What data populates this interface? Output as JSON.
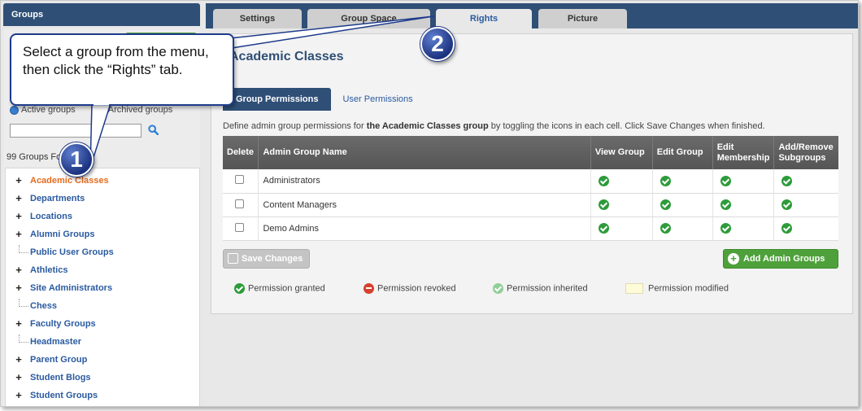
{
  "left_panel": {
    "header": "Groups",
    "radio_active": "Active groups",
    "radio_archived": "Archived groups",
    "search_value": "",
    "groups_found": "99 Groups Found",
    "tree": [
      {
        "label": "Academic Classes",
        "expandable": true,
        "active": true
      },
      {
        "label": "Departments",
        "expandable": true
      },
      {
        "label": "Locations",
        "expandable": true
      },
      {
        "label": "Alumni Groups",
        "expandable": true
      },
      {
        "label": "Public User Groups",
        "expandable": false
      },
      {
        "label": "Athletics",
        "expandable": true
      },
      {
        "label": "Site Administrators",
        "expandable": true
      },
      {
        "label": "Chess",
        "expandable": false
      },
      {
        "label": "Faculty Groups",
        "expandable": true
      },
      {
        "label": "Headmaster",
        "expandable": false
      },
      {
        "label": "Parent Group",
        "expandable": true
      },
      {
        "label": "Student Blogs",
        "expandable": true
      },
      {
        "label": "Student Groups",
        "expandable": true
      }
    ]
  },
  "tabs": [
    {
      "label": "Settings"
    },
    {
      "label": "Group Space"
    },
    {
      "label": "Rights",
      "active": true
    },
    {
      "label": "Picture"
    }
  ],
  "main": {
    "title": "Academic Classes",
    "sub_tabs": [
      {
        "label": "Group Permissions",
        "active": true
      },
      {
        "label": "User Permissions"
      }
    ],
    "description_pre": "Define admin group permissions for ",
    "description_bold": "the Academic Classes group",
    "description_post": " by toggling the icons in each cell. Click Save Changes when finished.",
    "table": {
      "headers": [
        "Delete",
        "Admin Group Name",
        "View Group",
        "Edit Group",
        "Edit Membership",
        "Add/Remove Subgroups"
      ],
      "rows": [
        {
          "name": "Administrators"
        },
        {
          "name": "Content Managers"
        },
        {
          "name": "Demo Admins"
        }
      ]
    },
    "save_button": "Save Changes",
    "add_button": "Add Admin Groups",
    "legend": {
      "granted": "Permission granted",
      "revoked": "Permission revoked",
      "inherited": "Permission inherited",
      "modified": "Permission modified"
    }
  },
  "callout": {
    "text": "Select a group from the menu, then click the “Rights” tab.",
    "badge1": "1",
    "badge2": "2"
  },
  "colors": {
    "header_blue": "#2f4f76",
    "link_blue": "#2a5aa0",
    "active_orange": "#e56b1f",
    "granted_green": "#2d9b3a",
    "add_button_green": "#4ea13a",
    "revoked_red": "#d64030",
    "inherited_green": "#8fcf96",
    "callout_border": "#1e3c8c"
  }
}
